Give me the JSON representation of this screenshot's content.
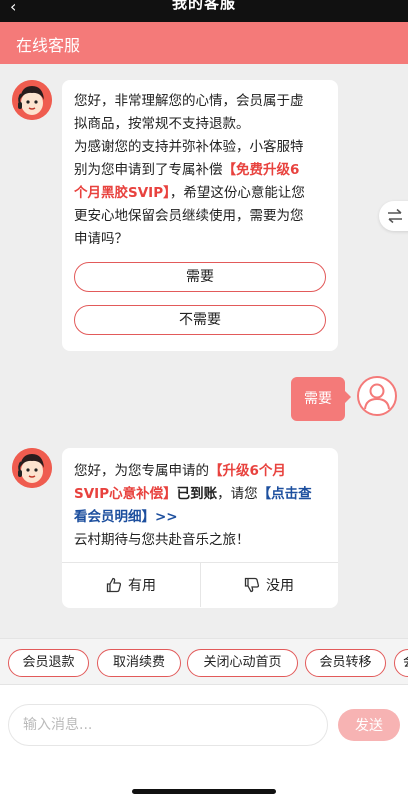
{
  "status_bar": {
    "back_glyph": "‹",
    "title_cut": "我的客服"
  },
  "header": {
    "title": "在线客服"
  },
  "messages": {
    "agent1": {
      "line1": "您好，非常理解您的心情，会员属于虚",
      "line2": "拟商品，按常规不支持退款。",
      "line3": "为感谢您的支持并弥补体验，小客服特",
      "line4a": "别为您申请到了专属补偿",
      "line4b": "【免费升级6",
      "line5a": "个月黑胶SVIP】",
      "line5b": "，希望这份心意能让您",
      "line6": "更安心地保留会员继续使用，需要为您",
      "line7": "申请吗？",
      "options": [
        "需要",
        "不需要"
      ]
    },
    "user1": {
      "text": "需要"
    },
    "agent2": {
      "line1a": "您好，为您专属申请的",
      "line1b": "【升级6个月",
      "line2a": "SVIP心意补偿】",
      "line2b": "已到账",
      "line2c": "，请您",
      "line2d": "【点击查",
      "line3a": "看会员明细】>>",
      "line4": "云村期待与您共赴音乐之旅！",
      "useful": "有用",
      "useless": "没用"
    }
  },
  "quick_replies": [
    "会员退款",
    "取消续费",
    "关闭心动首页",
    "会员转移",
    "会"
  ],
  "input": {
    "placeholder": "输入消息...",
    "value": "",
    "send_label": "发送"
  },
  "colors": {
    "brand": "#f47a79",
    "highlight_red": "#e8423e",
    "highlight_blue": "#1d4f9e",
    "send_disabled": "#f7b3b3"
  },
  "icons": [
    "back-chevron-icon",
    "swap-arrows-icon",
    "thumbs-up-icon",
    "thumbs-down-icon",
    "agent-avatar-icon",
    "user-avatar-icon"
  ]
}
